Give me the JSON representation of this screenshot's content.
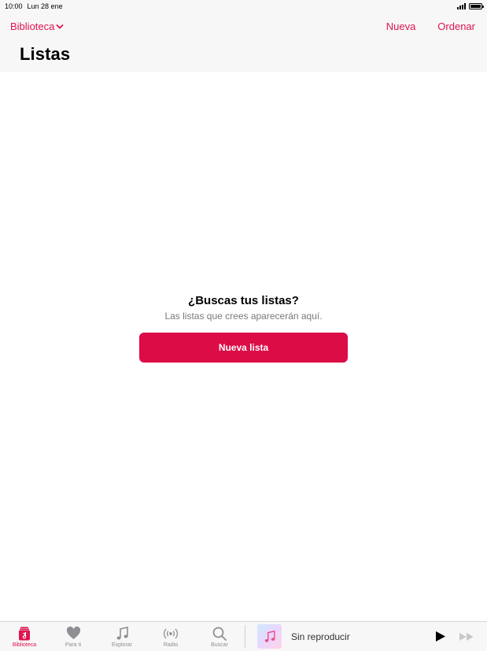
{
  "status_bar": {
    "time": "10:00",
    "date": "Lun 28 ene"
  },
  "header": {
    "library_label": "Biblioteca",
    "new_label": "Nueva",
    "sort_label": "Ordenar",
    "title": "Listas"
  },
  "empty_state": {
    "title": "¿Buscas tus listas?",
    "subtitle": "Las listas que crees aparecerán aquí.",
    "button_label": "Nueva lista"
  },
  "tab_bar": {
    "tabs": [
      {
        "label": "Biblioteca",
        "icon": "library-icon",
        "active": true
      },
      {
        "label": "Para ti",
        "icon": "heart-icon",
        "active": false
      },
      {
        "label": "Explorar",
        "icon": "music-note-icon",
        "active": false
      },
      {
        "label": "Radio",
        "icon": "radio-icon",
        "active": false
      },
      {
        "label": "Buscar",
        "icon": "search-icon",
        "active": false
      }
    ]
  },
  "now_playing": {
    "label": "Sin reproducir"
  },
  "colors": {
    "accent": "#e0134f",
    "button": "#dc0c47",
    "inactive": "#8e8e93"
  }
}
